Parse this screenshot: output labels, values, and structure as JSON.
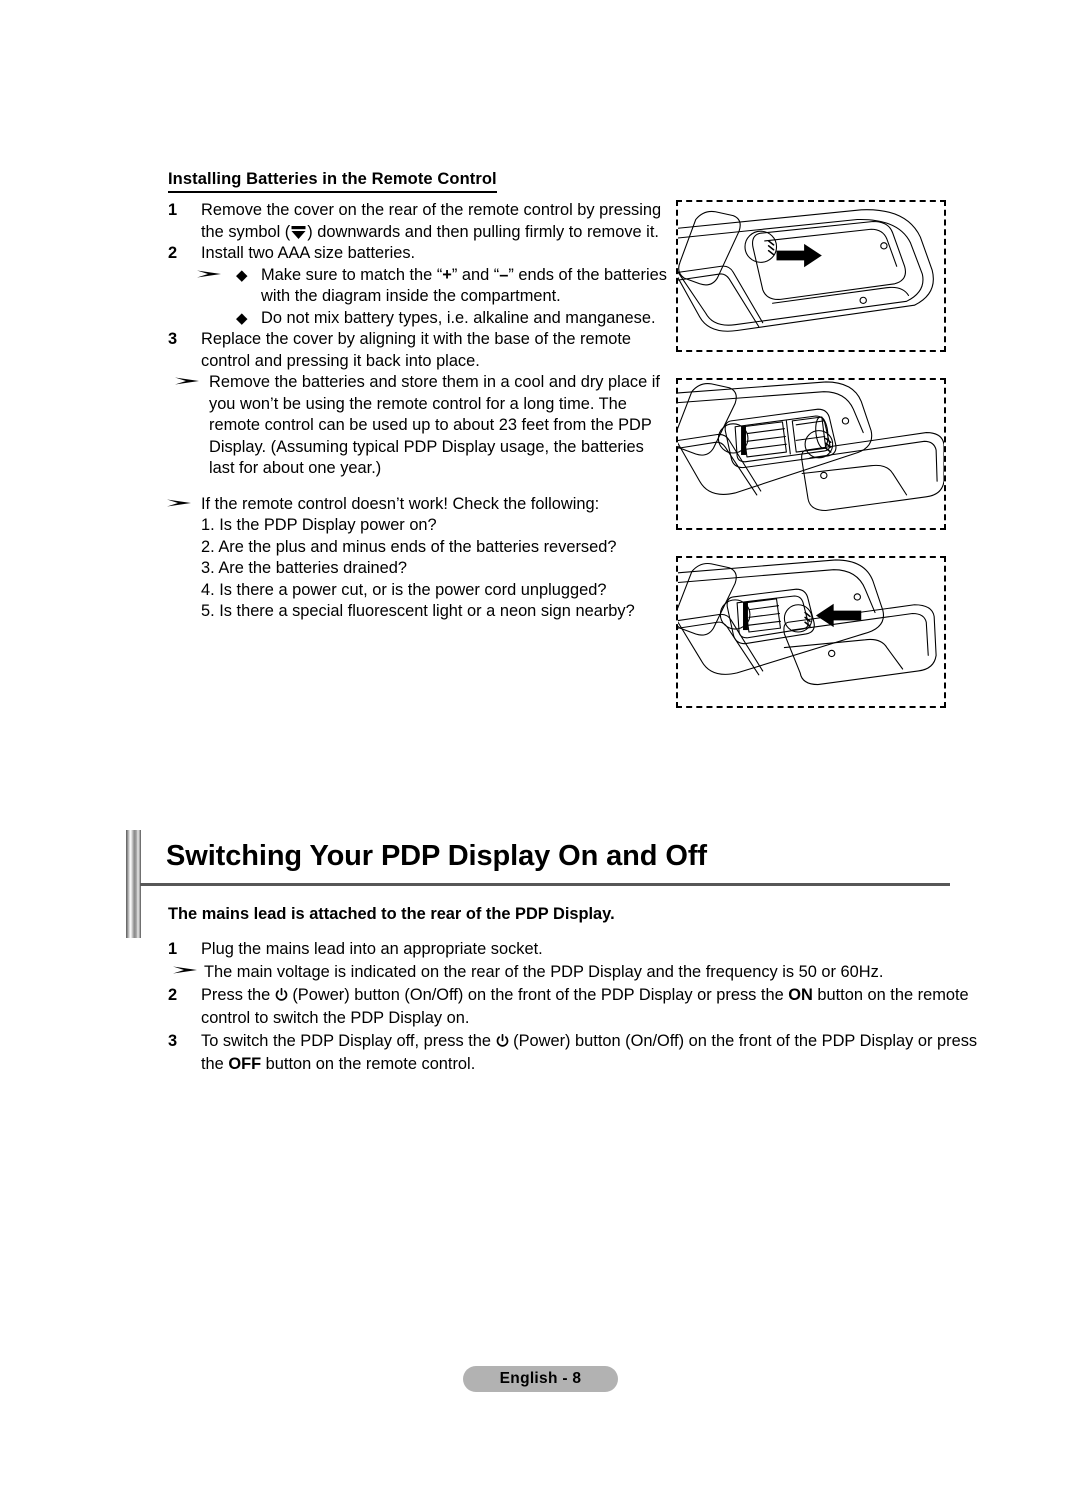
{
  "page": {
    "footer_label": "English - 8",
    "footer_bg": "#b2b2b2"
  },
  "battery_section": {
    "heading": "Installing Batteries in the Remote Control",
    "steps": [
      {
        "number": "1",
        "text_before_symbol": "Remove the cover on the rear of the remote control by pressing the symbol (",
        "symbol_name": "latch-down-symbol",
        "text_after_symbol": ") downwards and then pulling firmly to remove it."
      },
      {
        "number": "2",
        "text": "Install two AAA size batteries.",
        "sub_items": [
          {
            "marker": "arrow-diamond",
            "text_1": "Make sure to match the “",
            "bold_1": "+",
            "text_2": "” and “",
            "bold_2": "–",
            "text_3": "” ends of the batteries with the diagram inside the compartment."
          },
          {
            "marker": "diamond",
            "text_1": "Do not mix battery types, i.e. alkaline and manganese."
          }
        ]
      },
      {
        "number": "3",
        "text": "Replace the cover by aligning it with the base of the remote control and pressing it back into place.",
        "sub_arrow": "Remove the batteries and store them in a cool and dry place if you won’t be using the remote control for a long time. The remote control can be used up to about 23 feet from the PDP Display. (Assuming typical PDP Display usage, the batteries last for about one year.)"
      }
    ],
    "troubleshoot": {
      "intro": "If the remote control doesn’t work! Check the following:",
      "items": [
        "1. Is the PDP Display power on?",
        "2. Are the plus and minus ends of the batteries reversed?",
        "3. Are the batteries drained?",
        "4. Is there a power cut, or is the power cord unplugged?",
        "5. Is there a special fluorescent light or a neon sign nearby?"
      ]
    },
    "diagrams": [
      {
        "name": "remote-cover-slide-off",
        "arrow_direction": "right"
      },
      {
        "name": "remote-battery-compartment-open",
        "arrow_direction": "none"
      },
      {
        "name": "remote-cover-slide-on",
        "arrow_direction": "left"
      }
    ]
  },
  "pdp_section": {
    "title": "Switching Your PDP Display On and Off",
    "subtitle": "The mains lead is attached to the rear of the PDP Display.",
    "steps": [
      {
        "number": "1",
        "text": "Plug the mains lead into an appropriate socket.",
        "sub_arrow": "The main voltage is indicated on the rear of the PDP Display and the frequency is 50 or 60Hz."
      },
      {
        "number": "2",
        "part_1": "Press the ",
        "icon": "power-icon",
        "part_2": " (Power) button (On/Off) on the front of the PDP Display or press the ",
        "bold_1": "ON",
        "part_3": " button on the remote control to switch the PDP Display on."
      },
      {
        "number": "3",
        "part_1": "To switch the PDP Display off, press the ",
        "icon": "power-icon",
        "part_2": " (Power) button (On/Off) on the front of the PDP Display or press the ",
        "bold_1": "OFF",
        "part_3": " button on the remote control."
      }
    ]
  }
}
